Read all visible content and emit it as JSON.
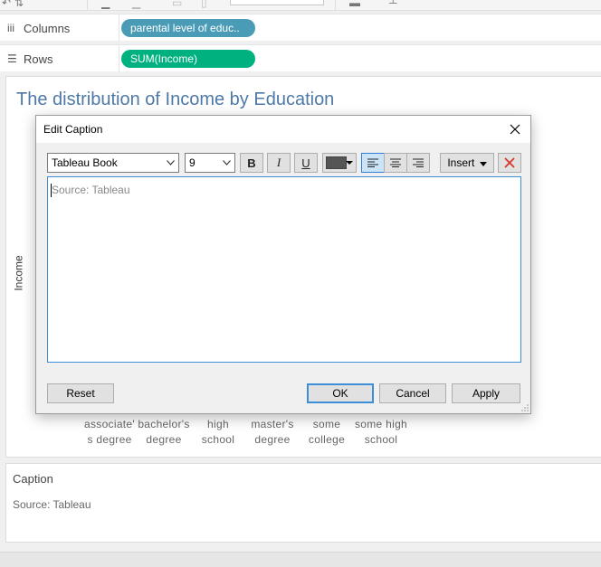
{
  "shelves": {
    "columns": {
      "label": "Columns",
      "icon": "columns-icon",
      "pill": "parental level of educ.."
    },
    "rows": {
      "label": "Rows",
      "icon": "rows-icon",
      "pill": "SUM(Income)"
    }
  },
  "viz": {
    "title": "The distribution of Income by Education",
    "y_axis_label": "Income",
    "x_categories": [
      [
        "associate'",
        "s degree"
      ],
      [
        "bachelor's",
        "degree"
      ],
      [
        "high",
        "school"
      ],
      [
        "master's",
        "degree"
      ],
      [
        "some",
        "college"
      ],
      [
        "some high",
        "school"
      ]
    ]
  },
  "caption_panel": {
    "title": "Caption",
    "text": "Source: Tableau"
  },
  "dialog": {
    "title": "Edit Caption",
    "font_family": "Tableau Book",
    "font_size": "9",
    "bold_label": "B",
    "italic_label": "I",
    "underline_label": "U",
    "insert_label": "Insert",
    "editor_text": "Source: Tableau",
    "reset_label": "Reset",
    "ok_label": "OK",
    "cancel_label": "Cancel",
    "apply_label": "Apply"
  },
  "colors": {
    "title_blue": "#4e79a7",
    "dimension_pill": "#4a9bb5",
    "measure_pill": "#00b180",
    "text_color_swatch": "#555555",
    "clear_red": "#d9362b"
  }
}
